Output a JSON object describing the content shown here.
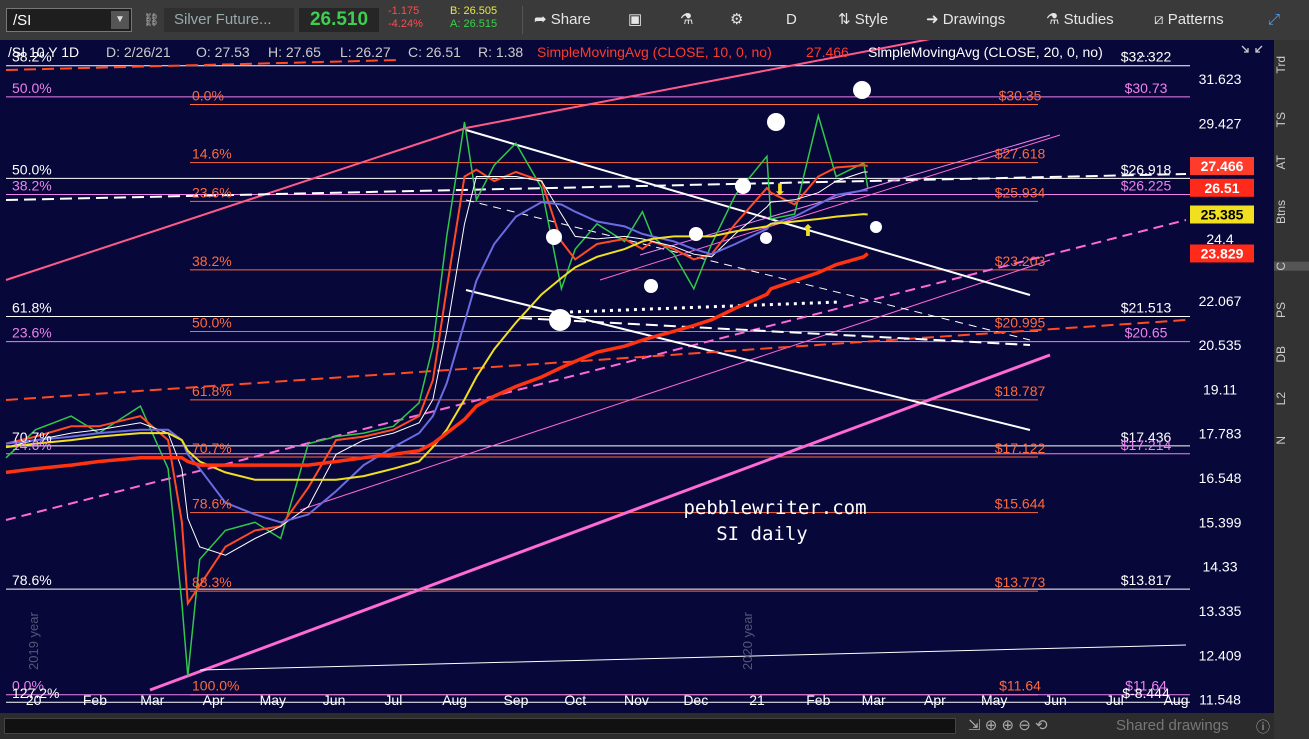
{
  "toolbar": {
    "symbol": "/SI",
    "instrument_name": "Silver Future...",
    "last_price": "26.510",
    "change": "-1.175",
    "change_pct": "-4.24%",
    "bid": "B: 26.505",
    "ask": "A: 26.515",
    "buttons": [
      "Share",
      "Style",
      "Drawings",
      "Studies",
      "Patterns"
    ],
    "period_label": "D"
  },
  "header": {
    "symbol_info": "/SI 10 Y 1D",
    "date": "D: 2/26/21",
    "open": "O: 27.53",
    "high": "H: 27.65",
    "low": "L: 26.27",
    "close": "C: 26.51",
    "range": "R: 1.38",
    "sma10_label": "SimpleMovingAvg (CLOSE, 10, 0, no)",
    "sma10_value": "27.466",
    "sma20_label": "SimpleMovingAvg (CLOSE, 20, 0, no)",
    "more": "..."
  },
  "watermark": {
    "line1": "pebblewriter.com",
    "line2": "SI daily",
    "year_2019": "2019 year",
    "year_2020": "2020 year"
  },
  "right_panel": [
    "Trd",
    "TS",
    "AT",
    "Btns",
    "C",
    "PS",
    "DB",
    "L2",
    "N"
  ],
  "bottom": {
    "shared_drawings": "Shared drawings"
  },
  "colors": {
    "background": "#07073a",
    "candle_up": "#2fc84a",
    "candle_down": "#ff3b2b",
    "sma10": "#ff4a22",
    "sma20": "#ffffff",
    "sma50": "#6a6ce0",
    "sma100": "#f0e020",
    "sma200": "#ff3311",
    "fib_orange": "#ff6a3a",
    "fib_pink": "#ee82ee"
  },
  "chart_data": {
    "type": "line",
    "x": [
      "2019-12-18",
      "2020-01-02",
      "2020-01-20",
      "2020-02-03",
      "2020-02-24",
      "2020-03-09",
      "2020-03-16",
      "2020-03-19",
      "2020-03-25",
      "2020-04-07",
      "2020-04-22",
      "2020-05-05",
      "2020-05-19",
      "2020-06-02",
      "2020-06-16",
      "2020-07-01",
      "2020-07-14",
      "2020-07-21",
      "2020-07-28",
      "2020-08-06",
      "2020-08-12",
      "2020-08-21",
      "2020-09-01",
      "2020-09-14",
      "2020-09-24",
      "2020-10-01",
      "2020-10-12",
      "2020-10-26",
      "2020-11-04",
      "2020-11-09",
      "2020-11-20",
      "2020-11-30",
      "2020-12-09",
      "2020-12-21",
      "2021-01-06",
      "2021-01-08",
      "2021-01-20",
      "2021-02-01",
      "2021-02-10",
      "2021-02-24",
      "2021-02-26"
    ],
    "series": [
      {
        "name": "/SI",
        "values": [
          17.1,
          17.9,
          18.3,
          17.8,
          18.6,
          16.8,
          13.5,
          12.0,
          14.5,
          15.2,
          15.4,
          15.0,
          17.5,
          17.7,
          17.8,
          18.0,
          18.7,
          20.5,
          24.5,
          29.5,
          26.0,
          27.5,
          28.5,
          26.5,
          22.5,
          24.0,
          25.0,
          24.3,
          25.5,
          24.5,
          23.8,
          22.5,
          24.2,
          26.2,
          27.9,
          25.2,
          25.4,
          29.8,
          27.0,
          27.6,
          26.51
        ]
      },
      {
        "name": "SMA 10",
        "values": [
          17.5,
          17.7,
          18.0,
          18.0,
          18.3,
          17.6,
          15.4,
          13.5,
          13.9,
          14.8,
          15.2,
          15.3,
          16.3,
          17.6,
          17.7,
          17.9,
          18.3,
          19.4,
          22.5,
          27.0,
          27.3,
          26.8,
          27.2,
          26.8,
          24.3,
          23.6,
          24.2,
          24.4,
          24.0,
          24.3,
          24.0,
          23.6,
          23.8,
          25.0,
          26.5,
          26.3,
          25.8,
          27.0,
          27.4,
          27.5,
          27.466
        ]
      },
      {
        "name": "SMA 20",
        "values": [
          17.4,
          17.6,
          17.8,
          17.9,
          18.1,
          17.8,
          16.8,
          15.5,
          14.8,
          14.6,
          15.0,
          15.3,
          15.8,
          17.2,
          17.6,
          17.8,
          18.1,
          18.8,
          21.0,
          25.0,
          27.0,
          27.0,
          27.0,
          26.8,
          25.4,
          24.5,
          24.4,
          24.5,
          24.4,
          24.3,
          24.1,
          23.8,
          23.7,
          24.6,
          25.7,
          25.9,
          26.0,
          26.3,
          26.8,
          27.2,
          27.2
        ]
      },
      {
        "name": "SMA 50",
        "values": [
          17.5,
          17.6,
          17.7,
          17.8,
          17.9,
          17.9,
          17.6,
          17.2,
          16.8,
          15.9,
          15.6,
          15.4,
          15.6,
          16.2,
          16.9,
          17.4,
          17.8,
          18.3,
          19.3,
          21.3,
          22.8,
          24.2,
          25.3,
          25.9,
          25.8,
          25.5,
          25.1,
          24.9,
          24.6,
          24.5,
          24.3,
          24.0,
          23.8,
          24.2,
          24.8,
          25.0,
          25.3,
          25.8,
          26.2,
          26.4,
          26.4
        ]
      },
      {
        "name": "SMA 100",
        "values": [
          17.4,
          17.5,
          17.6,
          17.7,
          17.8,
          17.8,
          17.6,
          17.3,
          17.0,
          16.7,
          16.5,
          16.5,
          16.5,
          16.5,
          16.6,
          16.8,
          17.0,
          17.4,
          17.9,
          18.8,
          19.5,
          20.4,
          21.3,
          22.3,
          22.9,
          23.3,
          23.7,
          24.0,
          24.3,
          24.4,
          24.5,
          24.5,
          24.5,
          24.7,
          24.9,
          25.0,
          25.1,
          25.2,
          25.3,
          25.4,
          25.385
        ]
      },
      {
        "name": "SMA 200",
        "values": [
          16.7,
          16.8,
          16.9,
          17.0,
          17.1,
          17.1,
          17.1,
          17.0,
          16.9,
          16.9,
          16.9,
          16.9,
          16.9,
          17.0,
          17.1,
          17.2,
          17.3,
          17.5,
          17.8,
          18.2,
          18.6,
          18.9,
          19.2,
          19.5,
          19.8,
          20.0,
          20.3,
          20.5,
          20.7,
          20.8,
          21.0,
          21.2,
          21.4,
          21.8,
          22.3,
          22.5,
          22.8,
          23.1,
          23.4,
          23.7,
          23.829
        ]
      }
    ],
    "ylim": [
      11.3,
      33.7
    ],
    "y_scale": "log",
    "price_ticks": [
      "31.623",
      "29.427",
      "24.4",
      "22.067",
      "20.535",
      "19.11",
      "17.783",
      "16.548",
      "15.399",
      "14.33",
      "13.335",
      "12.409",
      "11.548"
    ],
    "x_ticks": [
      "20",
      "Feb",
      "Mar",
      "Apr",
      "May",
      "Jun",
      "Jul",
      "Aug",
      "Sep",
      "Oct",
      "Nov",
      "Dec",
      "21",
      "Feb",
      "Mar",
      "Apr",
      "May",
      "Jun",
      "Jul",
      "Aug"
    ],
    "value_labels": [
      {
        "label": "27.466",
        "value": 27.466,
        "color": "#ff3b2b"
      },
      {
        "label": "26.51",
        "value": 26.51,
        "color": "#ff2a1a"
      },
      {
        "label": "25.385",
        "value": 25.385,
        "color": "#f0e020"
      },
      {
        "label": "23.829",
        "value": 23.829,
        "color": "#ff2a1a"
      }
    ],
    "fib_levels_right": [
      {
        "label": "$32.322",
        "value": 32.322,
        "color": "#ffffff"
      },
      {
        "label": "$30.35",
        "value": 30.35,
        "color": "#ff6a3a"
      },
      {
        "label": "$30.73",
        "value": 30.73,
        "color": "#ee82ee"
      },
      {
        "label": "$27.618",
        "value": 27.618,
        "color": "#ff6a3a"
      },
      {
        "label": "$26.918",
        "value": 26.918,
        "color": "#ffffff"
      },
      {
        "label": "$26.225",
        "value": 26.225,
        "color": "#ee82ee"
      },
      {
        "label": "$25.934",
        "value": 25.934,
        "color": "#ff6a3a"
      },
      {
        "label": "$23.203",
        "value": 23.203,
        "color": "#ff6a3a"
      },
      {
        "label": "$21.513",
        "value": 21.513,
        "color": "#ffffff"
      },
      {
        "label": "$20.995",
        "value": 20.995,
        "color": "#ff6a3a"
      },
      {
        "label": "$20.65",
        "value": 20.65,
        "color": "#ee82ee"
      },
      {
        "label": "$18.787",
        "value": 18.787,
        "color": "#ff6a3a"
      },
      {
        "label": "$17.436",
        "value": 17.436,
        "color": "#ffffff"
      },
      {
        "label": "$17.214",
        "value": 17.214,
        "color": "#ee82ee"
      },
      {
        "label": "$17.122",
        "value": 17.122,
        "color": "#ff6a3a"
      },
      {
        "label": "$15.644",
        "value": 15.644,
        "color": "#ff6a3a"
      },
      {
        "label": "$13.773",
        "value": 13.773,
        "color": "#ff6a3a"
      },
      {
        "label": "$13.817",
        "value": 13.817,
        "color": "#ffffff"
      },
      {
        "label": "$11.64",
        "value": 11.64,
        "color": "#ff6a3a"
      },
      {
        "label": "$11.64",
        "value": 11.64,
        "color": "#ee82ee"
      },
      {
        "label": "$-8.444",
        "value": 11.5,
        "color": "#ffffff"
      }
    ],
    "fib_pct_left": [
      {
        "label": "38.2%",
        "value": 32.322,
        "color": "#ffffff"
      },
      {
        "label": "50.0%",
        "value": 30.73,
        "color": "#ee82ee"
      },
      {
        "label": "50.0%",
        "value": 26.918,
        "color": "#ffffff"
      },
      {
        "label": "38.2%",
        "value": 26.225,
        "color": "#ee82ee"
      },
      {
        "label": "61.8%",
        "value": 21.513,
        "color": "#ffffff"
      },
      {
        "label": "23.6%",
        "value": 20.65,
        "color": "#ee82ee"
      },
      {
        "label": "70.7%",
        "value": 17.436,
        "color": "#ffffff"
      },
      {
        "label": "14.6%",
        "value": 17.214,
        "color": "#ee82ee"
      },
      {
        "label": "78.6%",
        "value": 13.817,
        "color": "#ffffff"
      },
      {
        "label": "0.0%",
        "value": 11.64,
        "color": "#ee82ee"
      },
      {
        "label": "127.2%",
        "value": 11.5,
        "color": "#ffffff"
      }
    ],
    "fib_pct_mid": [
      {
        "label": "0.0%",
        "value": 30.35
      },
      {
        "label": "14.6%",
        "value": 27.618
      },
      {
        "label": "23.6%",
        "value": 25.934
      },
      {
        "label": "38.2%",
        "value": 23.203
      },
      {
        "label": "50.0%",
        "value": 20.995
      },
      {
        "label": "61.8%",
        "value": 18.787
      },
      {
        "label": "70.7%",
        "value": 17.122
      },
      {
        "label": "78.6%",
        "value": 15.644
      },
      {
        "label": "88.3%",
        "value": 13.773
      },
      {
        "label": "100.0%",
        "value": 11.64
      }
    ]
  }
}
